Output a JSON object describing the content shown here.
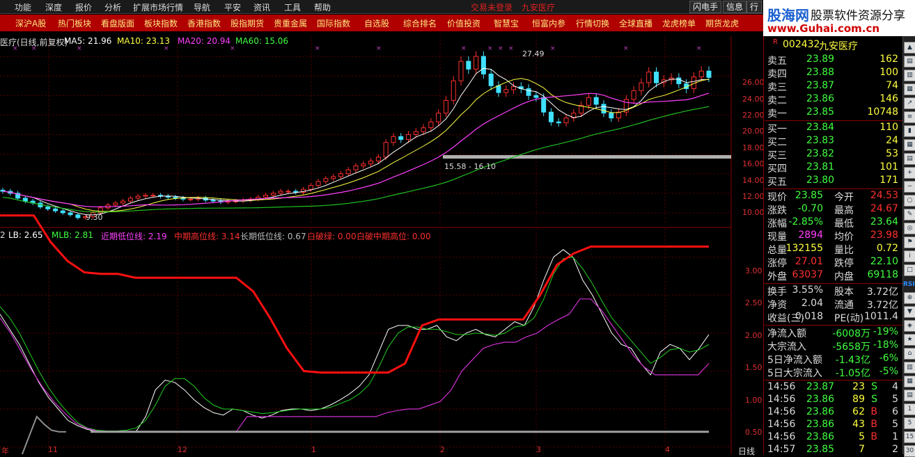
{
  "menu": {
    "items": [
      "功能",
      "深度",
      "报价",
      "分析",
      "扩展市场行情",
      "导航",
      "平安",
      "资讯",
      "工具",
      "帮助"
    ],
    "center": [
      "交易未登录",
      "九安医疗"
    ],
    "right": [
      "闪电手",
      "信息",
      "行"
    ]
  },
  "nav": [
    "深沪A股",
    "热门板块",
    "看盘版面",
    "板块指数",
    "香港指数",
    "股指期货",
    "贵重金属",
    "国际指数",
    "自选股",
    "综合排名",
    "价值投资",
    "智慧宝",
    "恒富内参",
    "行情切换",
    "全球直播",
    "龙虎榜单",
    "期货龙虎"
  ],
  "logo": {
    "cn": "股海网",
    "sub": "股票软件资源分享",
    "url": "www.Guhai.com.cn"
  },
  "main_info": {
    "name": "医疗(日线,前复权)",
    "ma5": "MA5: 21.96",
    "ma10": "MA10: 23.13",
    "ma20": "MA20: 20.94",
    "ma60": "MA60: 15.06",
    "high_label": "27.49",
    "low_label": "9.30",
    "range_label": "15.58 - 16.10"
  },
  "sub_info": {
    "p0": "2",
    "lb": "LB: 2.65",
    "mlb": "MLB: 2.81",
    "jq": "近期低位线: 2.19",
    "zq": "中期高位线: 3.14",
    "cq": "长期低位线: 0.67",
    "pl": "白破绿: 0.00",
    "pz": "白破中期高位: 0.00"
  },
  "y_main": [
    "26.00",
    "24.00",
    "22.00",
    "20.00",
    "18.00",
    "16.00",
    "14.00",
    "12.00",
    "10.00"
  ],
  "y_sub": [
    "3.00",
    "2.50",
    "2.00",
    "1.50",
    "1.00",
    "0.50"
  ],
  "x_labels": [
    "年",
    "11",
    "12",
    "1",
    "2",
    "3",
    "4"
  ],
  "period": "日线",
  "quote": {
    "code": "002432",
    "name": "九安医疗",
    "asks": [
      [
        "卖五",
        "23.89",
        "162"
      ],
      [
        "卖四",
        "23.88",
        "100"
      ],
      [
        "卖三",
        "23.87",
        "74"
      ],
      [
        "卖二",
        "23.86",
        "146"
      ],
      [
        "卖一",
        "23.85",
        "10748"
      ]
    ],
    "bids": [
      [
        "买一",
        "23.84",
        "110"
      ],
      [
        "买二",
        "23.83",
        "24"
      ],
      [
        "买三",
        "23.82",
        "53"
      ],
      [
        "买四",
        "23.81",
        "101"
      ],
      [
        "买五",
        "23.80",
        "171"
      ]
    ],
    "stats": [
      [
        "现价",
        "23.85",
        "今开",
        "24.53"
      ],
      [
        "涨跌",
        "-0.70",
        "最高",
        "24.67"
      ],
      [
        "涨幅",
        "-2.85%",
        "最低",
        "23.64"
      ],
      [
        "现量",
        "2894",
        "均价",
        "23.98"
      ],
      [
        "总量",
        "132155",
        "量比",
        "0.72"
      ],
      [
        "涨停",
        "27.01",
        "跌停",
        "22.10"
      ],
      [
        "外盘",
        "63037",
        "内盘",
        "69118"
      ]
    ],
    "fin": [
      [
        "换手",
        "3.55%",
        "股本",
        "3.72亿"
      ],
      [
        "净资",
        "2.04",
        "流通",
        "3.72亿"
      ],
      [
        "收益(三)",
        "0.018",
        "PE(动)",
        "1011.4"
      ]
    ],
    "flow": [
      [
        "净流入额",
        "-6008万",
        "-19%"
      ],
      [
        "大宗流入",
        "-5658万",
        "-18%"
      ],
      [
        "5日净流入额",
        "-1.43亿",
        "-6%"
      ],
      [
        "5日大宗流入",
        "-1.05亿",
        "-5%"
      ]
    ],
    "ticks": [
      [
        "14:56",
        "23.87",
        "23",
        "S",
        "4"
      ],
      [
        "14:56",
        "23.86",
        "89",
        "S",
        "5"
      ],
      [
        "14:56",
        "23.86",
        "62",
        "B",
        "6"
      ],
      [
        "14:56",
        "23.86",
        "43",
        "B",
        "5"
      ],
      [
        "14:56",
        "23.86",
        "5",
        "B",
        "1"
      ],
      [
        "14:57",
        "23.85",
        "7",
        "",
        "2"
      ]
    ]
  },
  "toolbar_labels": [
    "RSI"
  ],
  "chart_data": {
    "type": "candlestick",
    "main_ylim": [
      9,
      27.5
    ],
    "sub_ylim": [
      0.45,
      3.3
    ],
    "close": [
      12.2,
      12.0,
      11.5,
      11.2,
      11.0,
      10.6,
      10.4,
      10.2,
      10.0,
      9.8,
      9.5,
      9.6,
      10.0,
      10.5,
      10.8,
      11.0,
      11.2,
      11.5,
      11.7,
      11.8,
      11.8,
      11.7,
      11.6,
      11.5,
      11.4,
      11.4,
      11.5,
      11.3,
      11.2,
      11.1,
      11.2,
      11.2,
      11.3,
      11.4,
      11.6,
      11.8,
      12.0,
      12.2,
      12.2,
      12.1,
      12.4,
      12.8,
      13.2,
      13.5,
      13.7,
      14.0,
      14.4,
      14.8,
      15.0,
      15.3,
      15.7,
      17.2,
      17.8,
      17.5,
      18.0,
      18.3,
      18.7,
      19.3,
      20.2,
      21.5,
      23.5,
      25.5,
      24.7,
      26.0,
      24.2,
      23.0,
      22.3,
      22.6,
      22.9,
      22.7,
      22.0,
      21.8,
      20.3,
      19.3,
      19.2,
      19.7,
      20.2,
      21.0,
      21.8,
      21.1,
      20.2,
      19.7,
      20.3,
      21.6,
      22.5,
      23.3,
      24.4,
      23.3,
      23.6,
      23.8,
      23.2,
      22.7,
      23.9,
      24.5,
      23.85
    ],
    "white": [
      2.25,
      2.05,
      1.85,
      1.6,
      1.35,
      1.15,
      1.0,
      0.85,
      0.78,
      0.73,
      0.7,
      0.7,
      0.7,
      0.7,
      0.7,
      0.9,
      1.25,
      1.38,
      1.35,
      1.25,
      1.12,
      1.02,
      0.95,
      0.92,
      1.0,
      0.98,
      0.92,
      0.88,
      0.92,
      0.98,
      1.0,
      1.0,
      0.98,
      1.0,
      1.05,
      1.12,
      1.2,
      1.3,
      1.45,
      1.75,
      2.05,
      2.1,
      2.1,
      2.05,
      2.05,
      2.1,
      1.95,
      1.9,
      2.0,
      2.05,
      1.98,
      1.95,
      2.05,
      2.15,
      2.1,
      2.35,
      2.7,
      3.0,
      3.1,
      3.0,
      2.7,
      2.5,
      2.25,
      2.0,
      1.85,
      1.8,
      1.6,
      1.45,
      1.75,
      1.85,
      1.8,
      1.65,
      1.8,
      1.98
    ],
    "green": [
      2.35,
      2.2,
      2.0,
      1.75,
      1.5,
      1.28,
      1.1,
      0.95,
      0.82,
      0.75,
      0.72,
      0.71,
      0.71,
      0.72,
      0.75,
      0.85,
      1.05,
      1.3,
      1.4,
      1.4,
      1.3,
      1.15,
      1.05,
      1.0,
      1.0,
      0.98,
      0.96,
      0.94,
      0.95,
      0.97,
      0.99,
      1.0,
      1.0,
      1.0,
      1.02,
      1.07,
      1.12,
      1.2,
      1.32,
      1.55,
      1.82,
      2.0,
      2.08,
      2.08,
      2.05,
      2.05,
      2.02,
      1.98,
      1.98,
      2.0,
      1.99,
      1.97,
      2.0,
      2.08,
      2.1,
      2.2,
      2.45,
      2.78,
      2.98,
      3.0,
      2.85,
      2.65,
      2.42,
      2.2,
      2.05,
      1.9,
      1.75,
      1.6,
      1.68,
      1.78,
      1.8,
      1.75,
      1.78,
      1.85
    ],
    "purple": [
      2.2,
      2.0,
      1.75,
      1.5,
      1.28,
      1.1,
      0.95,
      0.82,
      0.75,
      0.71,
      0.7,
      0.7,
      0.7,
      0.7,
      0.7,
      0.7,
      0.7,
      0.7,
      0.7,
      0.7,
      0.7,
      0.7,
      0.7,
      0.9,
      0.9,
      0.9,
      0.9,
      0.9,
      0.9,
      0.9,
      0.9,
      0.9,
      0.9,
      0.9,
      0.9,
      0.9,
      0.95,
      0.98,
      1.0,
      1.0,
      1.05,
      1.1,
      1.25,
      1.5,
      1.65,
      1.8,
      1.85,
      1.88,
      1.88,
      1.95,
      2.0,
      2.1,
      2.18,
      2.25,
      2.45,
      2.45,
      2.3,
      2.1,
      1.9,
      1.7,
      1.55,
      1.45,
      1.45,
      1.45,
      1.45,
      1.45,
      1.6
    ],
    "red_step": [
      3.55,
      3.55,
      3.55,
      3.2,
      2.95,
      2.8,
      2.78,
      2.78,
      2.73,
      2.73,
      2.73,
      2.73,
      2.73,
      2.73,
      2.73,
      2.55,
      2.2,
      1.8,
      1.5,
      1.48,
      1.48,
      1.48,
      1.48,
      1.48,
      1.6,
      2.1,
      2.18,
      2.18,
      2.18,
      2.18,
      2.18,
      2.18,
      2.5,
      2.9,
      3.05,
      3.14,
      3.14,
      3.14,
      3.14,
      3.14,
      3.14,
      3.14,
      3.14
    ],
    "gray_base": [
      0.3,
      0.3,
      0.32,
      0.4,
      0.65,
      0.9,
      0.8,
      0.72,
      0.7,
      0.7
    ],
    "gray_level": 0.7
  }
}
